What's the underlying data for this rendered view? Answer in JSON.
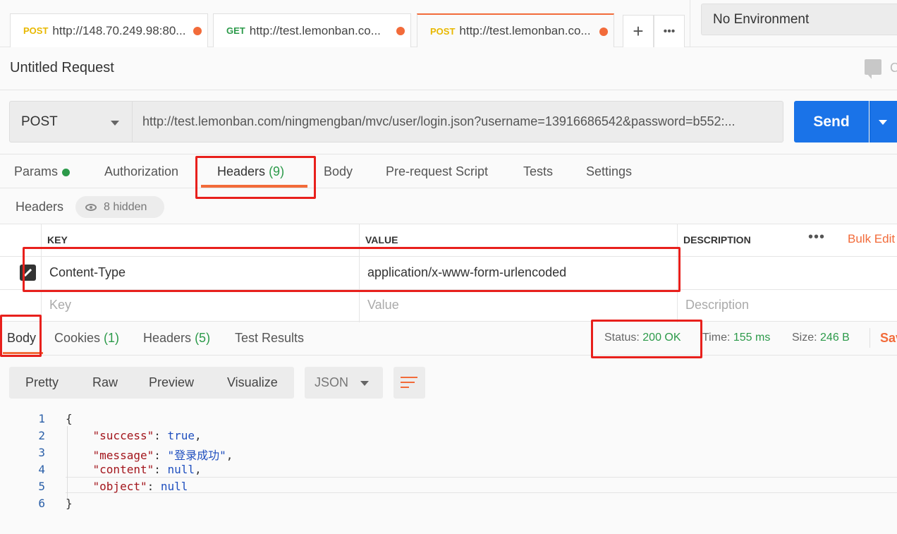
{
  "tabs": [
    {
      "method": "POST",
      "url": "http://148.70.249.98:80..."
    },
    {
      "method": "GET",
      "url": "http://test.lemonban.co..."
    },
    {
      "method": "POST",
      "url": "http://test.lemonban.co..."
    }
  ],
  "tab_actions": {
    "add": "+",
    "more": "•••"
  },
  "environment": "No Environment",
  "request": {
    "title": "Untitled Request",
    "comments_label": "C",
    "method": "POST",
    "url": "http://test.lemonban.com/ningmengban/mvc/user/login.json?username=13916686542&password=b552:...",
    "send": "Send"
  },
  "request_tabs": {
    "params": "Params",
    "authorization": "Authorization",
    "headers": "Headers",
    "headers_count": "(9)",
    "body": "Body",
    "prerequest": "Pre-request Script",
    "tests": "Tests",
    "settings": "Settings"
  },
  "headers_section": {
    "title": "Headers",
    "hidden": "8 hidden",
    "columns": {
      "key": "KEY",
      "value": "VALUE",
      "description": "DESCRIPTION"
    },
    "bulk_edit": "Bulk Edit",
    "more": "•••",
    "rows": [
      {
        "key": "Content-Type",
        "value": "application/x-www-form-urlencoded",
        "description": ""
      }
    ],
    "placeholder": {
      "key": "Key",
      "value": "Value",
      "description": "Description"
    }
  },
  "response_tabs": {
    "body": "Body",
    "cookies": "Cookies",
    "cookies_count": "(1)",
    "headers": "Headers",
    "headers_count": "(5)",
    "test_results": "Test Results"
  },
  "response_stats": {
    "status_label": "Status:",
    "status_value": "200 OK",
    "time_label": "Time:",
    "time_value": "155 ms",
    "size_label": "Size:",
    "size_value": "246 B",
    "save": "Sav"
  },
  "body_view": {
    "modes": [
      "Pretty",
      "Raw",
      "Preview",
      "Visualize"
    ],
    "format": "JSON"
  },
  "code_lines": [
    {
      "n": "1",
      "text": "{"
    },
    {
      "n": "2",
      "key": "\"success\"",
      "val": "true",
      "sep": ","
    },
    {
      "n": "3",
      "key": "\"message\"",
      "val": "\"登录成功\"",
      "sep": ","
    },
    {
      "n": "4",
      "key": "\"content\"",
      "val": "null",
      "sep": ","
    },
    {
      "n": "5",
      "key": "\"object\"",
      "val": "null",
      "sep": ""
    },
    {
      "n": "6",
      "text": "}"
    }
  ],
  "colors": {
    "accent": "#f26b3a",
    "send": "#1a73e8",
    "success": "#2c9a4a",
    "annotation": "#e8201c"
  }
}
